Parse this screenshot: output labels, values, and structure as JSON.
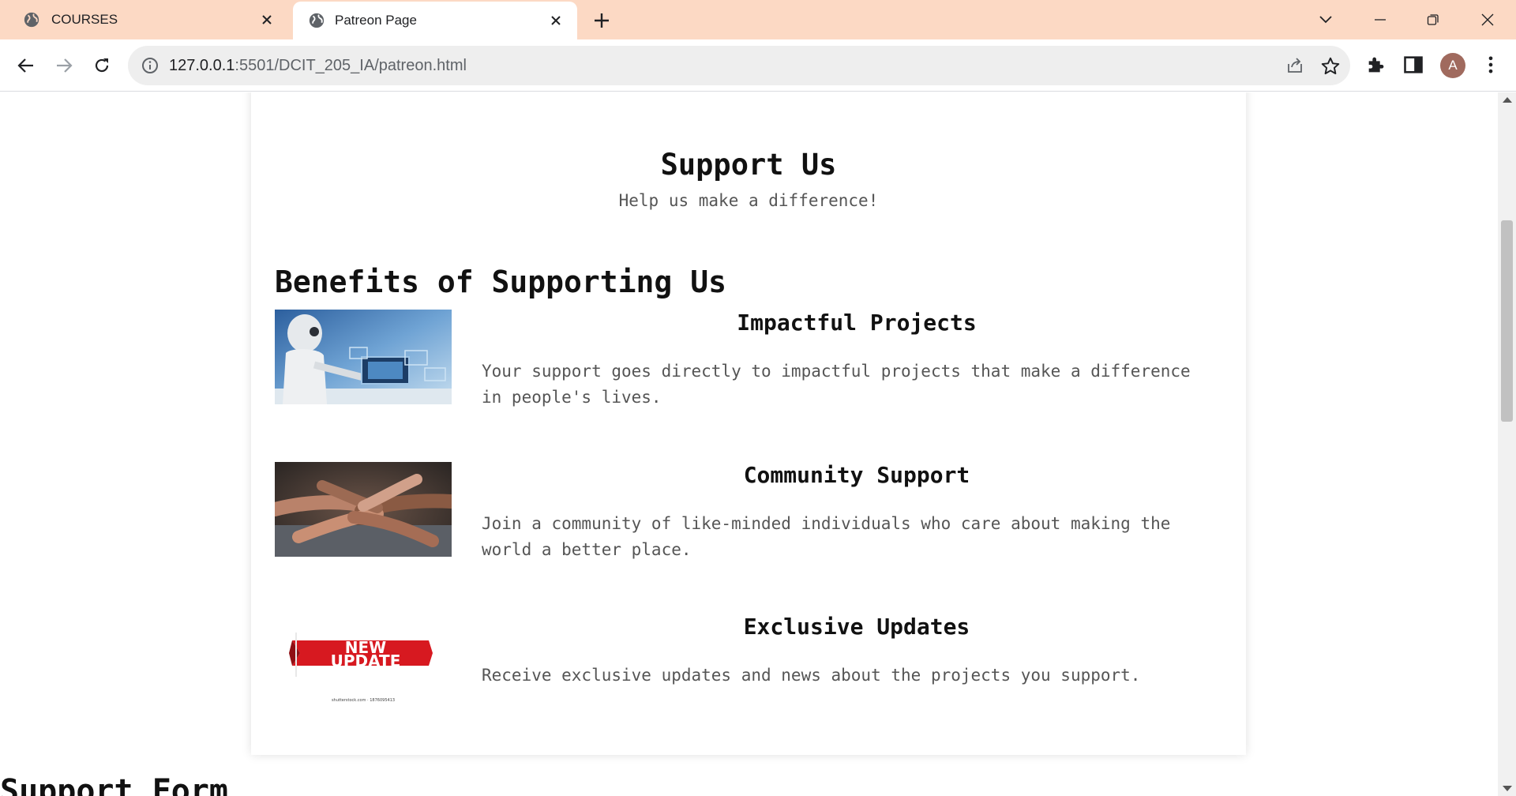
{
  "browser": {
    "tabs": [
      {
        "title": "COURSES",
        "active": false
      },
      {
        "title": "Patreon Page",
        "active": true
      }
    ],
    "url_host": "127.0.0.1",
    "url_path": ":5501/DCIT_205_IA/patreon.html",
    "profile_initial": "A",
    "tabstrip_color": "#fcd9c4"
  },
  "page": {
    "support_title": "Support Us",
    "support_subtitle": "Help us make a difference!",
    "benefits_title": "Benefits of Supporting Us",
    "benefits": [
      {
        "title": "Impactful Projects",
        "text": "Your support goes directly to impactful projects that make a difference in people's lives.",
        "image": "robot-laptop-image"
      },
      {
        "title": "Community Support",
        "text": "Join a community of like-minded individuals who care about making the world a better place.",
        "image": "stacked-hands-image"
      },
      {
        "title": "Exclusive Updates",
        "text": "Receive exclusive updates and news about the projects you support.",
        "image": "new-update-banner-image",
        "image_text_line1": "NEW",
        "image_text_line2": "UPDATE",
        "image_caption": "shutterstock.com · 1876095413"
      }
    ],
    "form_heading": "Support Form"
  }
}
